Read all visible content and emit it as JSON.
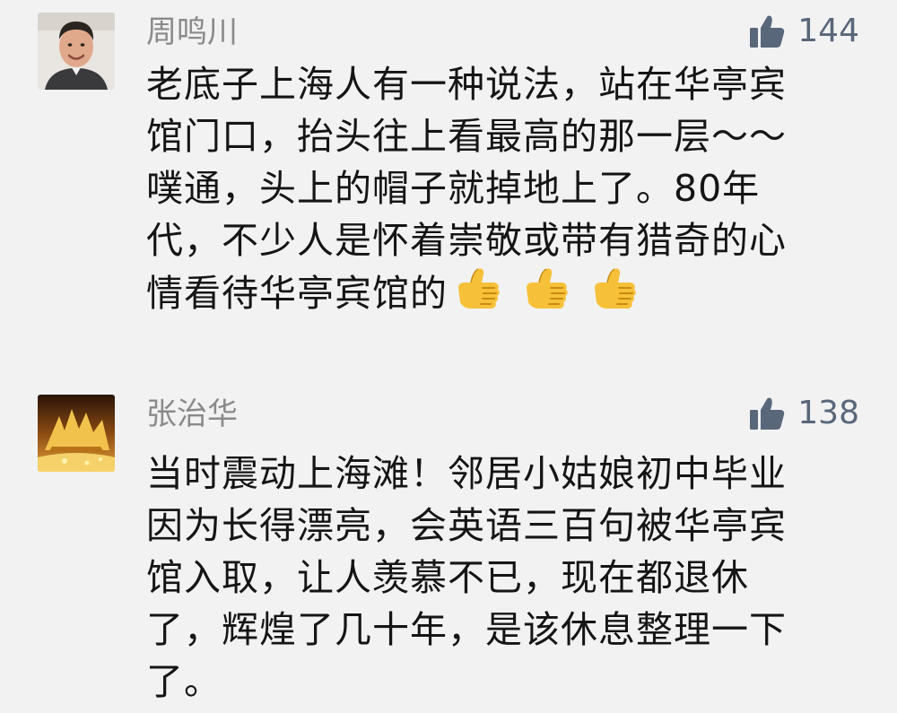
{
  "comments": [
    {
      "username": "周鸣川",
      "likes": "144",
      "lines": [
        "老底子上海人有一种说法，站在华亭宾",
        "馆门口，抬头往上看最高的那一层～～",
        "噗通，头上的帽子就掉地上了。80年",
        "代，不少人是怀着崇敬或带有猎奇的心",
        "情看待华亭宾馆的"
      ],
      "emoji": [
        "thumbs-up",
        "thumbs-up",
        "thumbs-up"
      ]
    },
    {
      "username": "张治华",
      "likes": "138",
      "lines": [
        "当时震动上海滩！邻居小姑娘初中毕业",
        "因为长得漂亮，会英语三百句被华亭宾",
        "馆入取，让人羡慕不已，现在都退休",
        "了，辉煌了几十年，是该休息整理一下",
        "了。"
      ]
    }
  ],
  "colors": {
    "background": "#f2f2f2",
    "username": "#8a8a8a",
    "like_icon": "#59677b",
    "text": "#151515"
  },
  "icons": {
    "like": "thumbs-up-icon",
    "emoji": "thumbs-up-emoji"
  }
}
